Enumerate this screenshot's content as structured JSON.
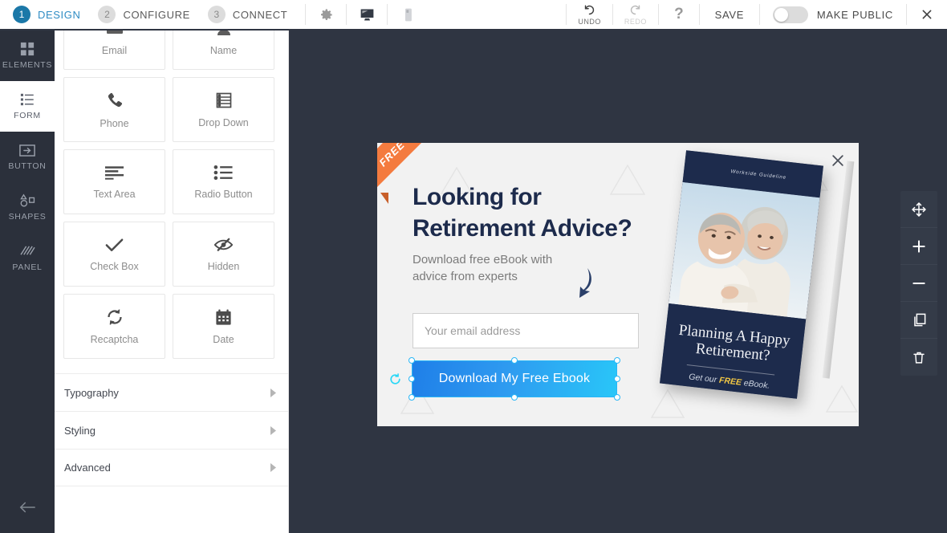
{
  "header": {
    "steps": [
      {
        "num": "1",
        "label": "DESIGN",
        "active": true
      },
      {
        "num": "2",
        "label": "CONFIGURE",
        "active": false
      },
      {
        "num": "3",
        "label": "CONNECT",
        "active": false
      }
    ],
    "settings_icon": "gear-icon",
    "desktop_icon": "desktop-monitor-icon",
    "mobile_icon": "mobile-phone-icon",
    "undo_label": "UNDO",
    "redo_label": "REDO",
    "help_label": "?",
    "save_label": "SAVE",
    "make_public_label": "MAKE PUBLIC",
    "close_label": "✕"
  },
  "rail": {
    "items": [
      {
        "label": "ELEMENTS",
        "icon": "grid-squares-icon",
        "active": false
      },
      {
        "label": "FORM",
        "icon": "form-list-icon",
        "active": true
      },
      {
        "label": "BUTTON",
        "icon": "button-arrow-icon",
        "active": false
      },
      {
        "label": "SHAPES",
        "icon": "shapes-icon",
        "active": false
      },
      {
        "label": "PANEL",
        "icon": "panel-hatch-icon",
        "active": false
      }
    ],
    "back_icon": "back-arrow-icon"
  },
  "panel": {
    "cards": [
      {
        "label": "Email",
        "icon": "envelope-icon"
      },
      {
        "label": "Name",
        "icon": "user-icon"
      },
      {
        "label": "Phone",
        "icon": "phone-icon"
      },
      {
        "label": "Drop Down",
        "icon": "dropdown-list-icon"
      },
      {
        "label": "Text Area",
        "icon": "text-area-icon"
      },
      {
        "label": "Radio Button",
        "icon": "radio-button-icon"
      },
      {
        "label": "Check Box",
        "icon": "checkmark-icon"
      },
      {
        "label": "Hidden",
        "icon": "eye-slash-icon"
      },
      {
        "label": "Recaptcha",
        "icon": "refresh-circle-icon"
      },
      {
        "label": "Date",
        "icon": "calendar-icon"
      }
    ],
    "accordions": [
      {
        "label": "Typography",
        "icon": "chevron-right-icon"
      },
      {
        "label": "Styling",
        "icon": "chevron-right-icon"
      },
      {
        "label": "Advanced",
        "icon": "chevron-right-icon"
      }
    ]
  },
  "popup": {
    "ribbon_text": "FREE",
    "close_icon": "close-icon",
    "headline_line1": "Looking for",
    "headline_line2": "Retirement Advice?",
    "subtext": "Download free eBook with advice from experts",
    "arrow_icon": "curved-arrow-icon",
    "email_placeholder": "Your email address",
    "cta_label": "Download My Free Ebook",
    "rotate_icon": "rotate-handle-icon",
    "gear_icon": "gear-icon",
    "book": {
      "top_label": "Workside Guideline",
      "title": "Planning A Happy Retirement?",
      "subtitle_pre": "Get our ",
      "subtitle_em": "FREE",
      "subtitle_post": " eBook."
    }
  },
  "right_tools": [
    {
      "name": "move-tool",
      "icon": "move-arrows-icon"
    },
    {
      "name": "zoom-in-tool",
      "icon": "plus-icon"
    },
    {
      "name": "zoom-out-tool",
      "icon": "minus-icon"
    },
    {
      "name": "duplicate-tool",
      "icon": "copy-icon"
    },
    {
      "name": "delete-tool",
      "icon": "trash-icon"
    }
  ],
  "colors": {
    "canvas_bg": "#2f3542",
    "rail_bg": "#2b303b",
    "accent_blue": "#1b78a8",
    "step_active_text": "#2f8cc4",
    "ribbon_orange": "#f47b3f",
    "headline_navy": "#1d2b4c",
    "cta_gradient_start": "#1f7fe8",
    "cta_gradient_end": "#29c6f8",
    "selection_cyan": "#29b6f6",
    "popup_bg": "#f2f2f2",
    "book_navy": "#1d2b4c",
    "book_highlight_yellow": "#f2c744"
  }
}
